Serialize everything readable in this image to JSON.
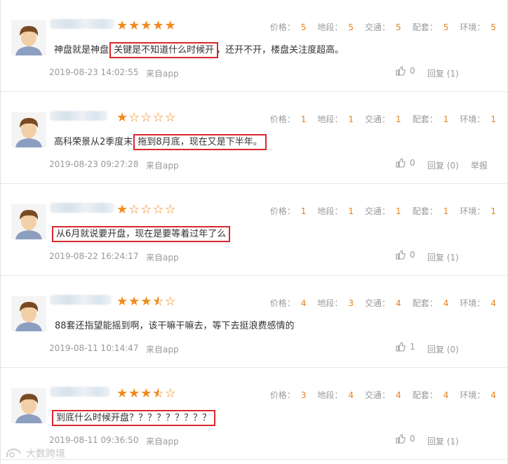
{
  "rating_labels": [
    "价格：",
    "地段：",
    "交通：",
    "配套：",
    "环境："
  ],
  "like_icon": "thumbs-up-icon",
  "colors": {
    "accent": "#f08a1e",
    "value": "#e8821a",
    "highlight": "#d9272e",
    "muted": "#999999"
  },
  "reviews": [
    {
      "stars": 5,
      "ratings": [
        "5",
        "5",
        "5",
        "5",
        "5"
      ],
      "content_pre": "神盘就是神盘",
      "content_hl": "关键是不知道什么时候开",
      "content_post": "，还开不开，楼盘关注度超高。",
      "date": "2019-08-23 14:02:55",
      "source": "来自app",
      "likes": "0",
      "reply": "回复 (1)",
      "report": ""
    },
    {
      "stars": 1,
      "ratings": [
        "1",
        "1",
        "1",
        "1",
        "1"
      ],
      "content_pre": "高科荣景从2季度末",
      "content_hl": "拖到8月底，现在又是下半年。",
      "content_post": "",
      "date": "2019-08-23 09:27:28",
      "source": "来自app",
      "likes": "0",
      "reply": "回复 (0)",
      "report": "举报"
    },
    {
      "stars": 1,
      "ratings": [
        "1",
        "1",
        "1",
        "1",
        "1"
      ],
      "content_pre": "",
      "content_hl": "从6月就说要开盘，现在是要等着过年了么",
      "content_post": "",
      "date": "2019-08-22 16:24:17",
      "source": "来自app",
      "likes": "0",
      "reply": "回复 (1)",
      "report": ""
    },
    {
      "stars": 3.5,
      "ratings": [
        "4",
        "3",
        "4",
        "4",
        "4"
      ],
      "content_pre": "88套还指望能摇到啊，该干嘛干嘛去，等下去挺浪费感情的",
      "content_hl": "",
      "content_post": "",
      "date": "2019-08-11 10:14:47",
      "source": "来自app",
      "likes": "1",
      "reply": "回复 (0)",
      "report": ""
    },
    {
      "stars": 3.5,
      "ratings": [
        "3",
        "4",
        "4",
        "4",
        "4"
      ],
      "content_pre": "",
      "content_hl": "到底什么时候开盘？？？？？？？？？",
      "content_post": "",
      "date": "2019-08-11 09:36:50",
      "source": "来自app",
      "likes": "0",
      "reply": "回复 (1)",
      "report": ""
    }
  ],
  "watermark": "大数跨境"
}
